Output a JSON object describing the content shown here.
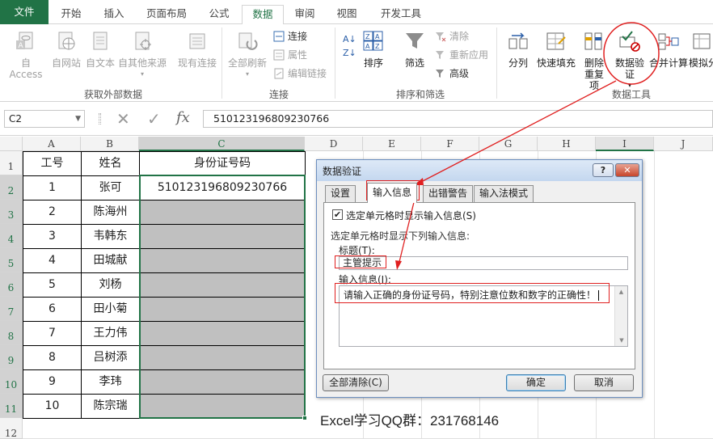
{
  "tabs": [
    "文件",
    "开始",
    "插入",
    "页面布局",
    "公式",
    "数据",
    "审阅",
    "视图",
    "开发工具"
  ],
  "ribbon": {
    "get_external": {
      "buttons": [
        "自 Access",
        "自网站",
        "自文本",
        "自其他来源",
        "现有连接"
      ],
      "label": "获取外部数据"
    },
    "connections": {
      "refresh": "全部刷新",
      "items": [
        "连接",
        "属性",
        "编辑链接"
      ],
      "label": "连接"
    },
    "sort_filter": {
      "sort": "排序",
      "filter": "筛选",
      "items": [
        "清除",
        "重新应用",
        "高级"
      ],
      "label": "排序和筛选"
    },
    "data_tools": {
      "split": "分列",
      "flash": "快速填充",
      "dedup": "删除重复项",
      "validation": "数据验证",
      "consolidate": "合并计算",
      "whatif": "模拟分",
      "label": "数据工具"
    }
  },
  "formula_bar": {
    "name_box": "C2",
    "fx": "fx",
    "value": "510123196809230766"
  },
  "columns": [
    "A",
    "B",
    "C",
    "D",
    "E",
    "F",
    "G",
    "H",
    "I",
    "J"
  ],
  "rows": [
    "1",
    "2",
    "3",
    "4",
    "5",
    "6",
    "7",
    "8",
    "9",
    "10",
    "11",
    "12"
  ],
  "table": {
    "headers": [
      "工号",
      "姓名",
      "身份证号码"
    ],
    "rows": [
      {
        "id": "1",
        "name": "张可",
        "idno": "510123196809230766"
      },
      {
        "id": "2",
        "name": "陈海州",
        "idno": ""
      },
      {
        "id": "3",
        "name": "韦韩东",
        "idno": ""
      },
      {
        "id": "4",
        "name": "田城献",
        "idno": ""
      },
      {
        "id": "5",
        "name": "刘杨",
        "idno": ""
      },
      {
        "id": "6",
        "name": "田小菊",
        "idno": ""
      },
      {
        "id": "7",
        "name": "王力伟",
        "idno": ""
      },
      {
        "id": "8",
        "name": "吕树添",
        "idno": ""
      },
      {
        "id": "9",
        "name": "李玮",
        "idno": ""
      },
      {
        "id": "10",
        "name": "陈宗瑞",
        "idno": ""
      }
    ]
  },
  "dialog": {
    "title": "数据验证",
    "help": "?",
    "close": "✕",
    "tabs": [
      "设置",
      "输入信息",
      "出错警告",
      "输入法模式"
    ],
    "show_checkbox": "选定单元格时显示输入信息(S)",
    "group_label": "选定单元格时显示下列输入信息:",
    "title_label": "标题(T):",
    "title_value": "主管提示",
    "message_label": "输入信息(I):",
    "message_value": "请输入正确的身份证号码，特别注意位数和数字的正确性！",
    "clear_all": "全部清除(C)",
    "ok": "确定",
    "cancel": "取消"
  },
  "caption": "Excel学习QQ群：231768146"
}
